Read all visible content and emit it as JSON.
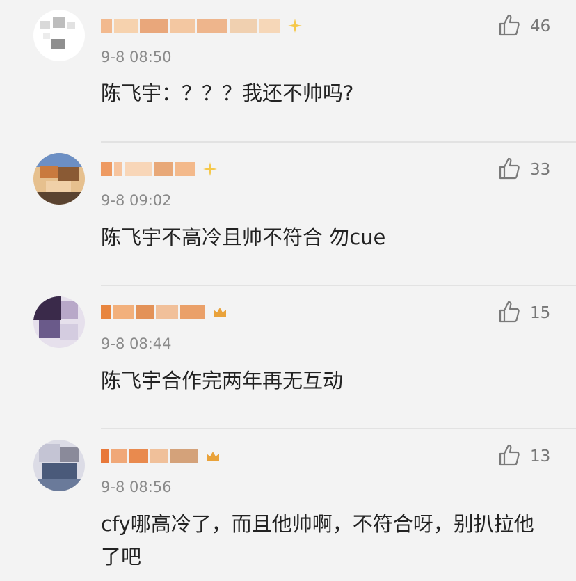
{
  "comments": [
    {
      "time": "9-8 08:50",
      "text": "陈飞宇：？？？我还不帅吗?",
      "likes": "46",
      "avatar_colors": [
        "#ffffff",
        "#d8d8d8",
        "#9a9a9a",
        "#e9e9e9"
      ],
      "name_colors": [
        "#f2b98e",
        "#f6d2ae",
        "#e9a77b",
        "#f3c7a1",
        "#eeb58c",
        "#f0d0b0"
      ]
    },
    {
      "time": "9-8 09:02",
      "text": "陈飞宇不高冷且帅不符合 勿cue",
      "likes": "33",
      "avatar_colors": [
        "#6c8fc4",
        "#c97a3e",
        "#e8c08a",
        "#5a4330"
      ],
      "name_colors": [
        "#ee9a62",
        "#f6c49e",
        "#e8a878",
        "#f3b98b"
      ]
    },
    {
      "time": "9-8 08:44",
      "text": "陈飞宇合作完两年再无互动",
      "likes": "15",
      "avatar_colors": [
        "#3a2a4a",
        "#6a5a8a",
        "#b8a8c8",
        "#e6e0ec"
      ],
      "name_colors": [
        "#e8853e",
        "#f2b07c",
        "#e39258",
        "#f1c09a",
        "#eaa069"
      ]
    },
    {
      "time": "9-8 08:56",
      "text": "cfy哪高冷了，而且他帅啊，不符合呀，别扒拉他了吧",
      "likes": "13",
      "avatar_colors": [
        "#8a8a9a",
        "#c4c4d4",
        "#4a5a7a",
        "#dcdce6"
      ],
      "name_colors": [
        "#e8783a",
        "#f0a878",
        "#e98a4e",
        "#f0c09a",
        "#d4a27a"
      ]
    }
  ],
  "badge_color": "#f5c84a"
}
